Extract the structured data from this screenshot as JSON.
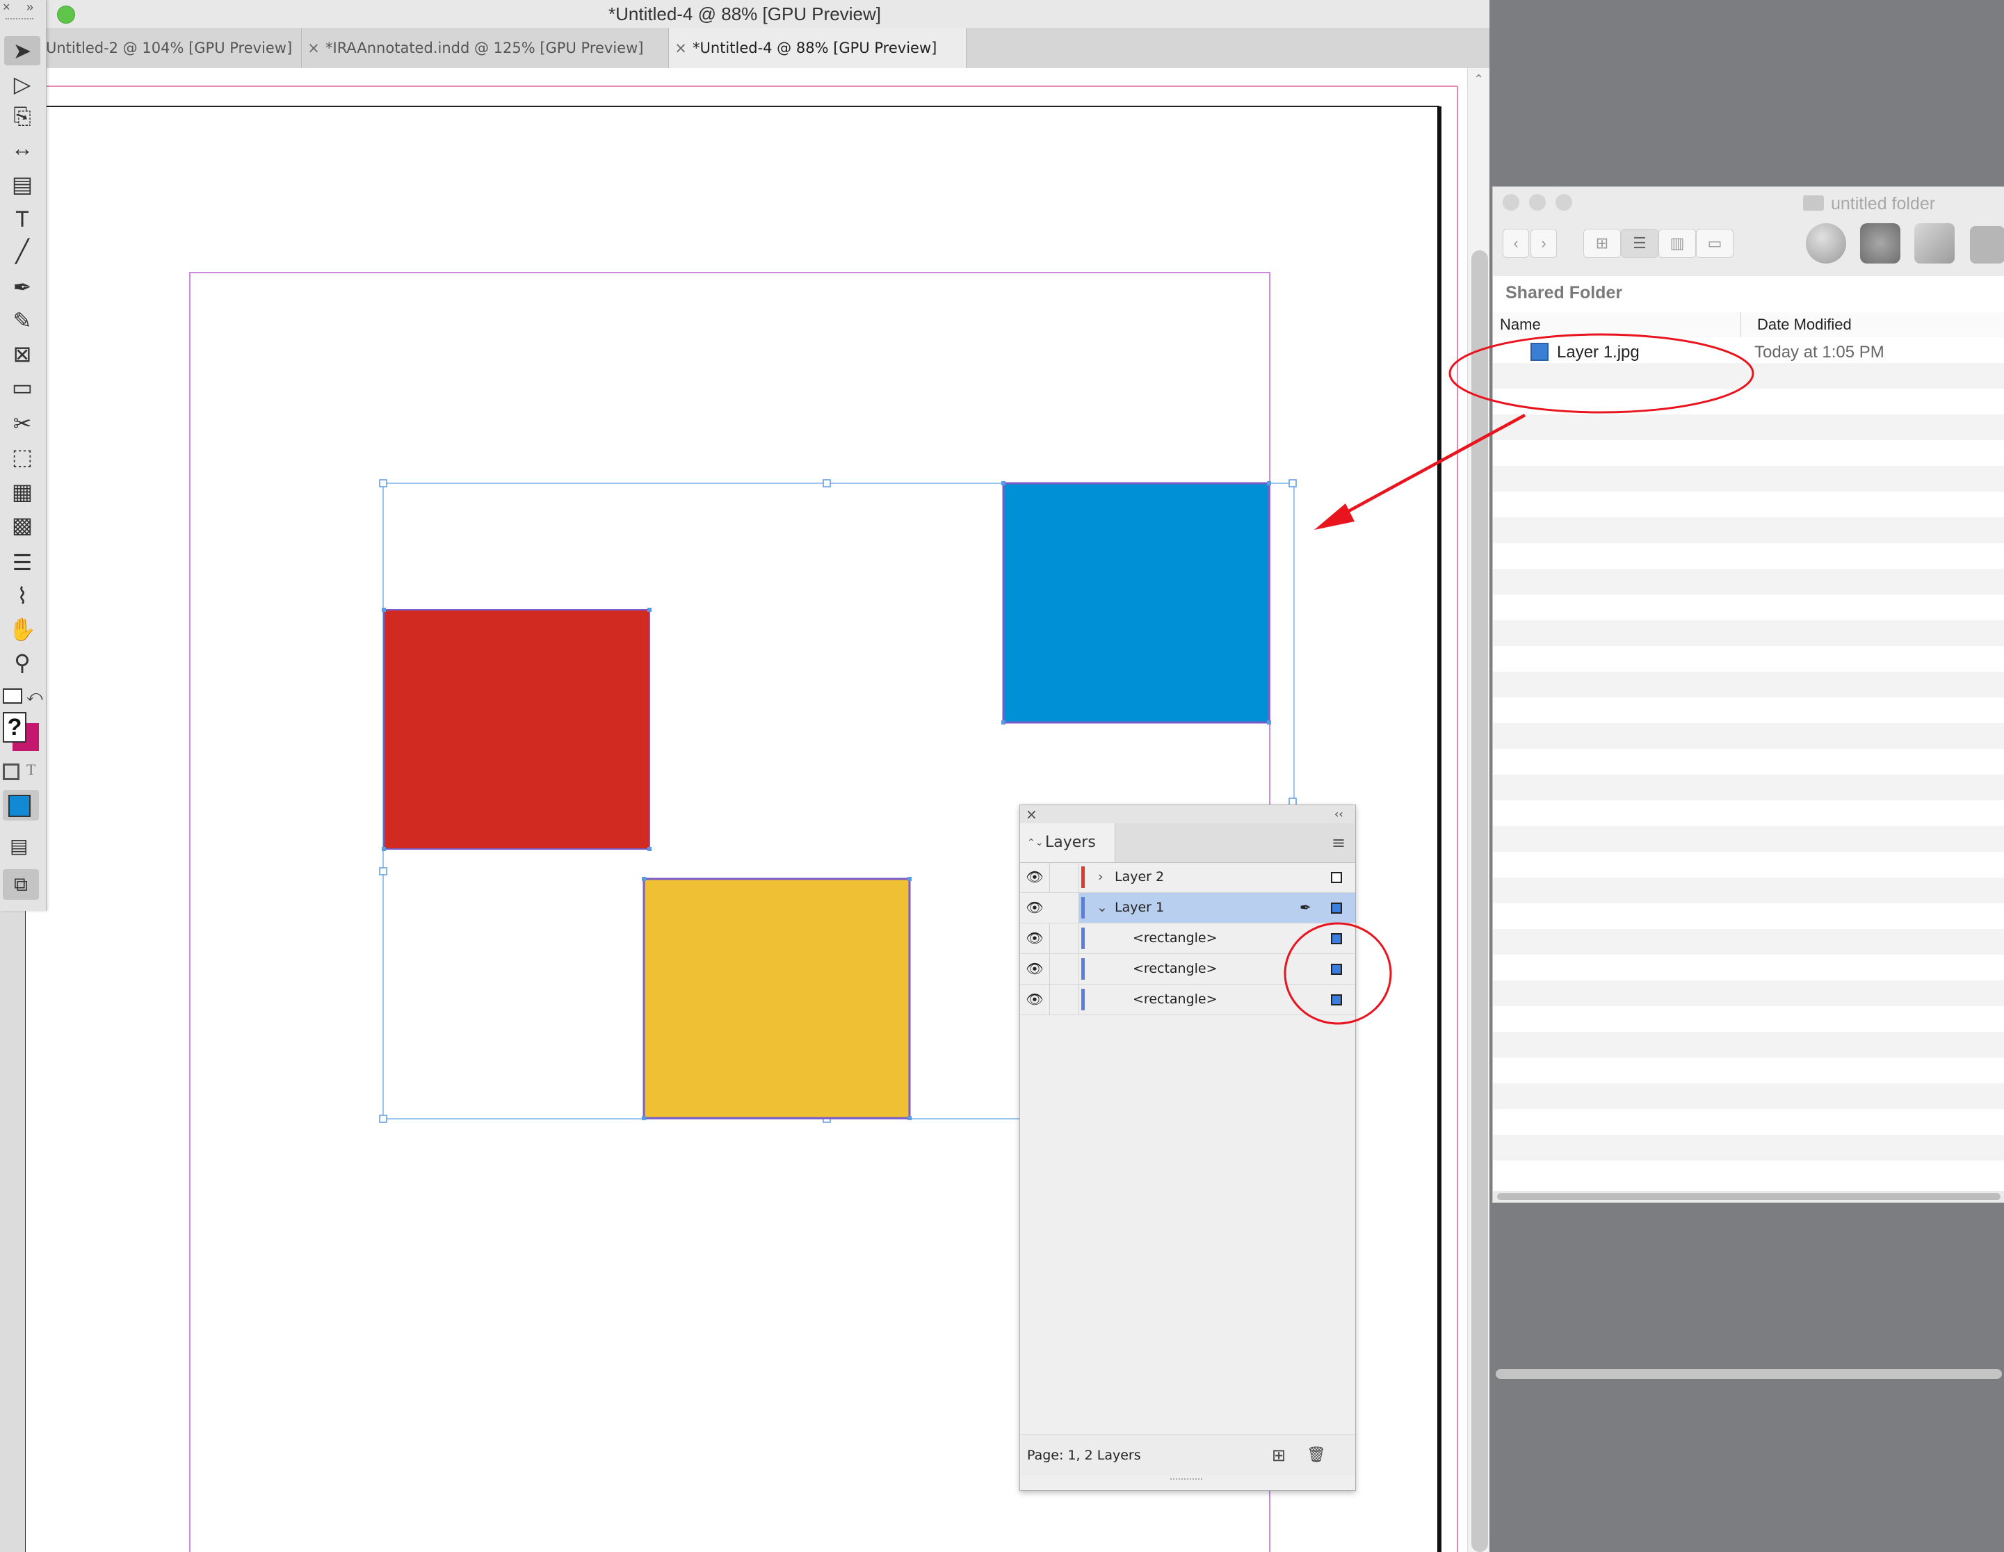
{
  "window": {
    "title": "*Untitled-4 @ 88% [GPU Preview]",
    "tabs": [
      {
        "label": "Untitled-2 @ 104% [GPU Preview]",
        "close": ""
      },
      {
        "label": "*IRAAnnotated.indd @ 125% [GPU Preview]",
        "close": "×"
      },
      {
        "label": "*Untitled-4 @ 88% [GPU Preview]",
        "close": "×"
      }
    ],
    "collapse_glyph": "»",
    "close_glyph": "×"
  },
  "toolbar": {
    "tools": [
      {
        "name": "selection-tool-icon",
        "glyph": "➤"
      },
      {
        "name": "direct-selection-tool-icon",
        "glyph": "▷"
      },
      {
        "name": "page-tool-icon",
        "glyph": "⎘"
      },
      {
        "name": "gap-tool-icon",
        "glyph": "↔"
      },
      {
        "name": "content-collector-icon",
        "glyph": "▤"
      },
      {
        "name": "type-tool-icon",
        "glyph": "T"
      },
      {
        "name": "line-tool-icon",
        "glyph": "╱"
      },
      {
        "name": "pen-tool-icon",
        "glyph": "✒"
      },
      {
        "name": "pencil-tool-icon",
        "glyph": "✎"
      },
      {
        "name": "rectangle-frame-tool-icon",
        "glyph": "⊠"
      },
      {
        "name": "rectangle-tool-icon",
        "glyph": "▭"
      },
      {
        "name": "scissors-tool-icon",
        "glyph": "✂"
      },
      {
        "name": "free-transform-tool-icon",
        "glyph": "⬚"
      },
      {
        "name": "gradient-swatch-tool-icon",
        "glyph": "▦"
      },
      {
        "name": "gradient-feather-tool-icon",
        "glyph": "▩"
      },
      {
        "name": "note-tool-icon",
        "glyph": "☰"
      },
      {
        "name": "eyedropper-tool-icon",
        "glyph": "⌇"
      },
      {
        "name": "hand-tool-icon",
        "glyph": "✋"
      },
      {
        "name": "zoom-tool-icon",
        "glyph": "⚲"
      }
    ],
    "fill_stroke_question": "?",
    "formatting_text_glyph": "T"
  },
  "colors": {
    "red": "#d12b21",
    "blue": "#0090d6",
    "yellow": "#f0c034",
    "frame_purple": "#7a5cc8",
    "selection_blue": "#7ab2e8",
    "annotation_red": "#e8141e",
    "margin_pink": "#e88ab0",
    "guide_purple": "#c98adf",
    "stroke_magenta": "#c4186e"
  },
  "layers_panel": {
    "close_glyph": "×",
    "collapse_glyph": "‹‹",
    "tab_label": "Layers",
    "tab_arrows": "⌃⌄",
    "menu_glyph": "≡",
    "rows": [
      {
        "label": "Layer 2",
        "disclosure": "›",
        "bar_color": "#e03a2c",
        "eye": "👁"
      },
      {
        "label": "Layer 1",
        "disclosure": "⌄",
        "bar_color": "#5a7fe0",
        "eye": "👁",
        "pen": "✒"
      },
      {
        "label": "<rectangle>",
        "bar_color": "#5a7fe0",
        "eye": "👁"
      },
      {
        "label": "<rectangle>",
        "bar_color": "#5a7fe0",
        "eye": "👁"
      },
      {
        "label": "<rectangle>",
        "bar_color": "#5a7fe0",
        "eye": "👁"
      }
    ],
    "footer_text": "Page: 1, 2 Layers",
    "new_layer_glyph": "⊞",
    "delete_glyph": "🗑"
  },
  "finder": {
    "title": "untitled folder",
    "folder_glyph": "▬",
    "back_glyph": "‹",
    "forward_glyph": "›",
    "view_icons": [
      "⊞",
      "☰",
      "▥",
      "▭"
    ],
    "sidebar_header": "Shared Folder",
    "columns": {
      "name": "Name",
      "date": "Date Modified"
    },
    "files": [
      {
        "name": "Layer 1.jpg",
        "date": "Today at 1:05 PM"
      }
    ]
  }
}
